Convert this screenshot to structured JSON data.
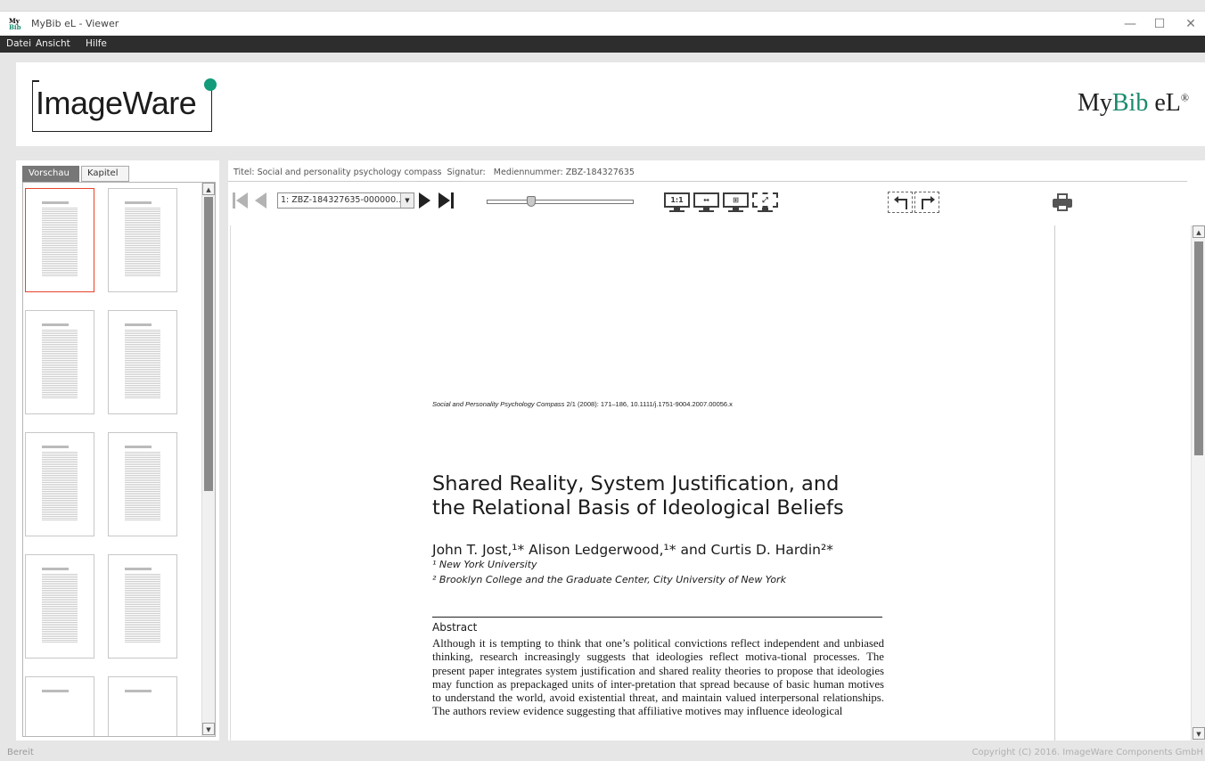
{
  "window": {
    "title": "MyBib eL - Viewer",
    "app_icon_text_top": "My",
    "app_icon_text_bottom": "Bib",
    "minimize": "—",
    "maximize": "☐",
    "close": "✕"
  },
  "menu": [
    "Datei",
    "Ansicht",
    "Hilfe"
  ],
  "banner": {
    "logo": "ImageWare",
    "brand_my": "My",
    "brand_bib": "Bib",
    "brand_el": " eL",
    "brand_reg": "®"
  },
  "sidebar": {
    "tabs": [
      {
        "label": "Vorschau",
        "active": true
      },
      {
        "label": "Kapitel",
        "active": false
      }
    ],
    "thumbnail_count": 10,
    "selected_thumbnail": 1
  },
  "info": {
    "titel_label": "Titel:",
    "titel_value": "Social and personality psychology compass",
    "signatur_label": "Signatur:",
    "signatur_value": "",
    "mediennummer_label": "Mediennummer:",
    "mediennummer_value": "ZBZ-184327635"
  },
  "toolbar": {
    "page_select_value": "1: ZBZ-184327635-000000...",
    "zoom_buttons": [
      "1:1",
      "fit-width",
      "fit-page",
      "fullscreen"
    ],
    "zoom_1to1_label": "1:1",
    "zoom_fitwidth_label": "↔",
    "zoom_fitpage_label": "⊞",
    "fullscreen_label": "⤢"
  },
  "document": {
    "journal_line_italic": "Social and Personality Psychology Compass",
    "journal_line_rest": " 2/1 (2008): 171–186, 10.1111/j.1751-9004.2007.00056.x",
    "title_line1": "Shared Reality, System Justification, and",
    "title_line2": "the Relational Basis of Ideological Beliefs",
    "authors": "John T. Jost,¹* Alison Ledgerwood,¹* and Curtis D. Hardin²*",
    "affiliation1": "¹ New York University",
    "affiliation2": "² Brooklyn College and the Graduate Center, City University of New York",
    "abstract_heading": "Abstract",
    "abstract_text": "Although it is tempting to think that one’s political convictions reflect independent and unbiased thinking, research increasingly suggests that ideologies reflect motiva-tional processes. The present paper integrates system justification and shared reality theories to propose that ideologies may function as prepackaged units of inter-pretation that spread because of basic human motives to understand the world, avoid existential threat, and maintain valued interpersonal relationships. The authors review evidence suggesting that affiliative motives may influence ideological"
  },
  "status": {
    "text": "Bereit",
    "copyright": "Copyright (C) 2016. ImageWare Components GmbH"
  },
  "colors": {
    "accent_green": "#1a8a6e",
    "selection_red": "#e8432a",
    "menubar_bg": "#2d2d2d"
  }
}
